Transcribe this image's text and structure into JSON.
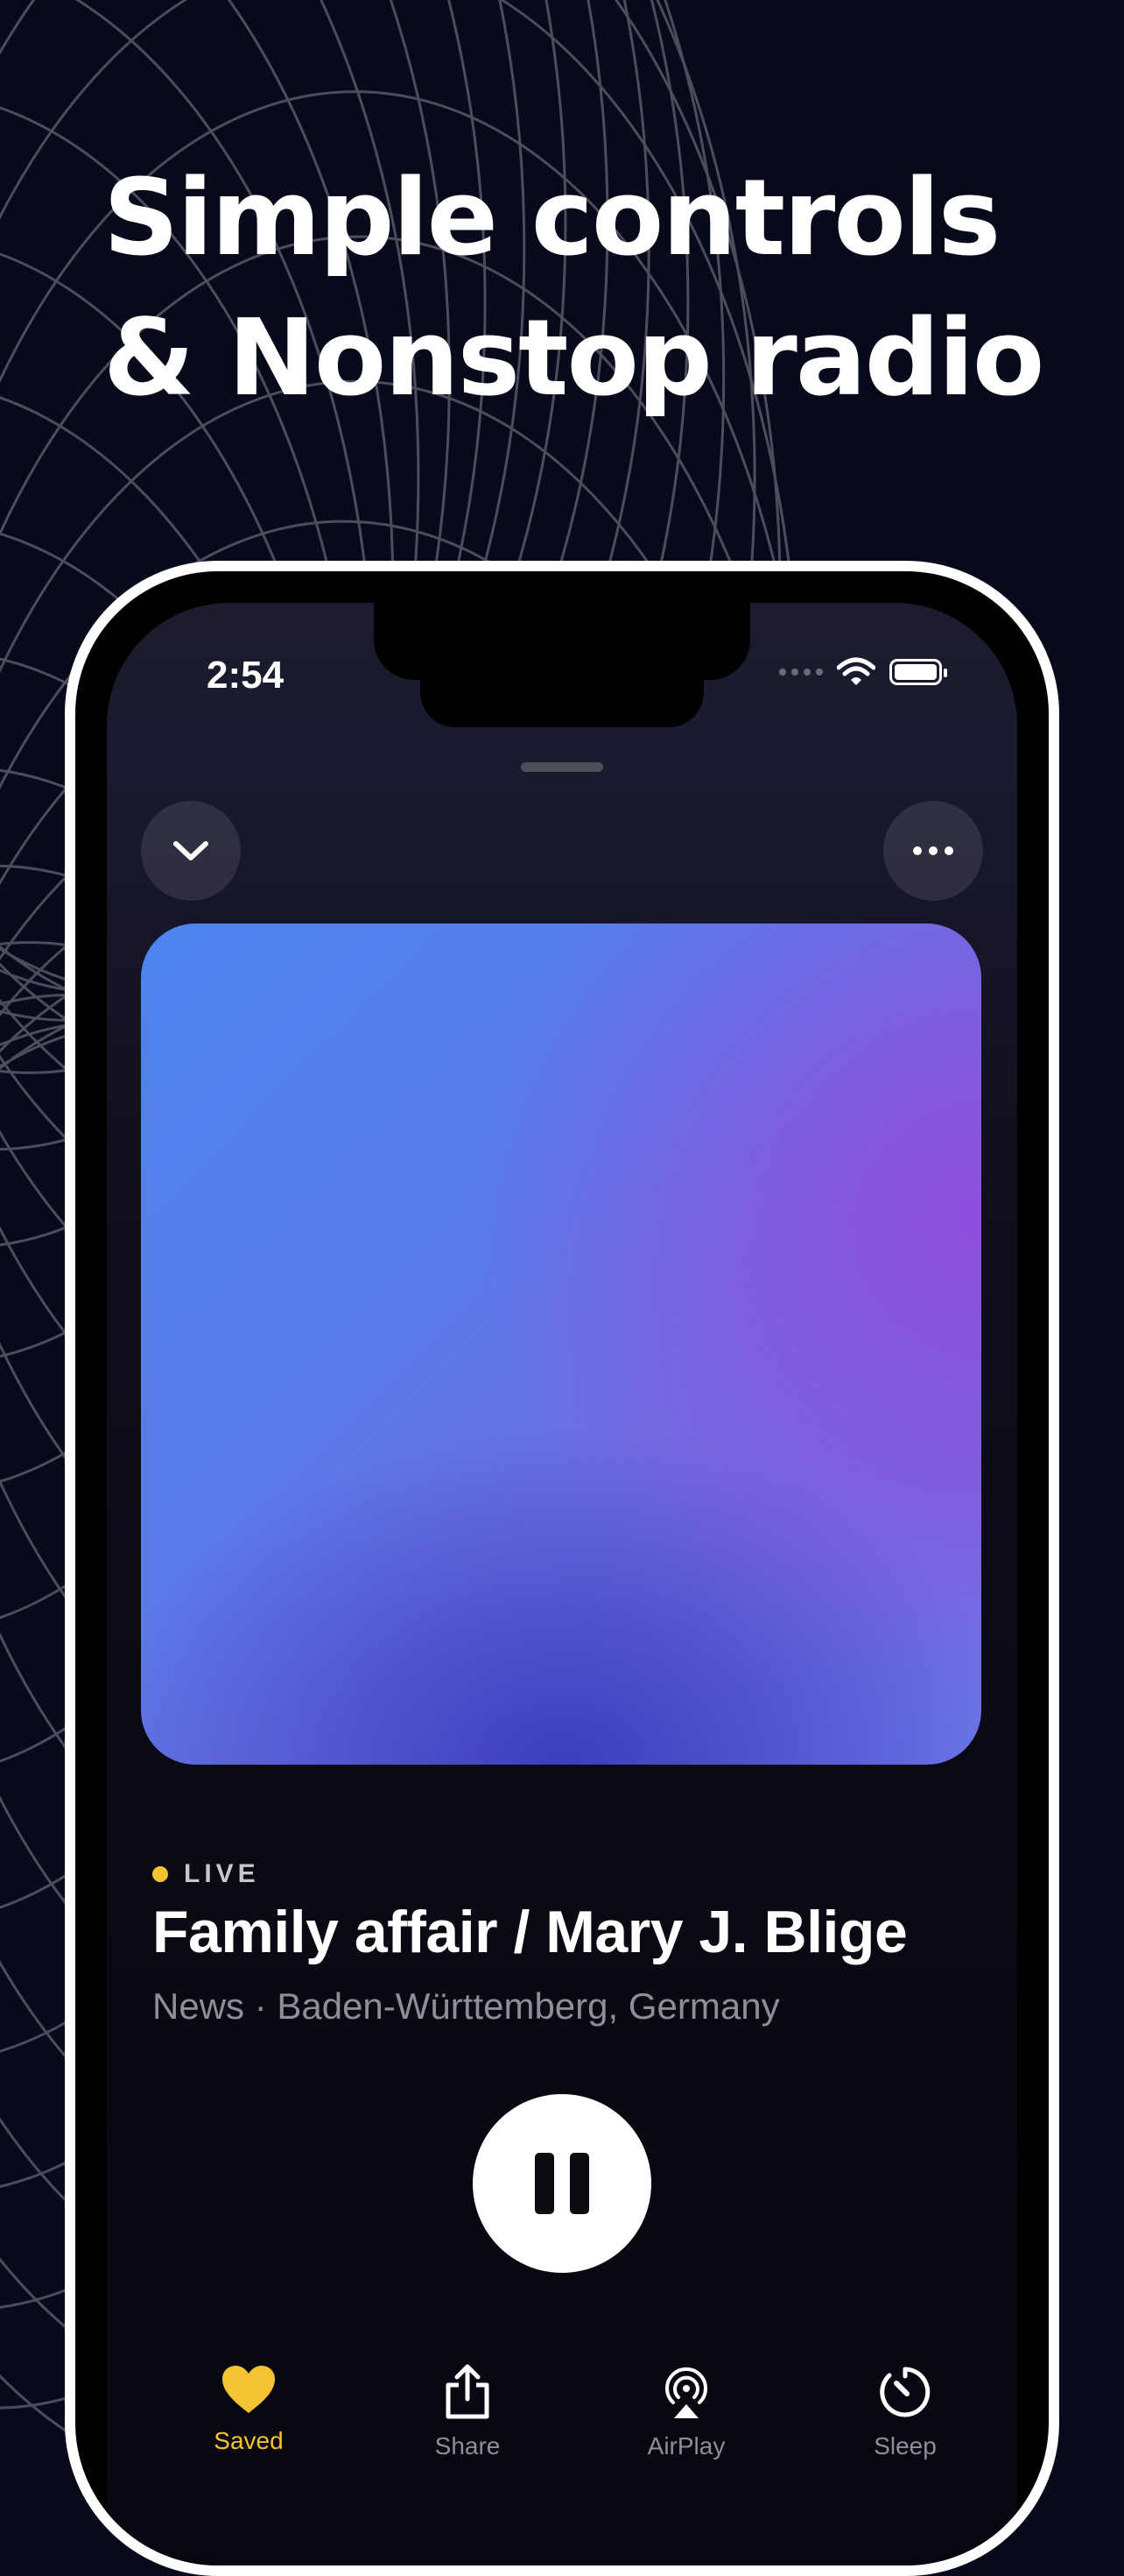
{
  "headline": {
    "line1": "Simple controls",
    "line2": "& Nonstop radio"
  },
  "status_bar": {
    "time": "2:54",
    "icons": [
      "signal-icon",
      "wifi-icon",
      "battery-icon"
    ]
  },
  "player": {
    "collapse_icon": "chevron-down-icon",
    "more_icon": "more-icon",
    "live_label": "LIVE",
    "track_title": "Family affair / Mary J. Blige",
    "subtitle": "News · Baden-Württemberg, Germany",
    "state": "playing",
    "artwork_colors": [
      "#4e84ee",
      "#8f4fdc",
      "#3a3fbc"
    ]
  },
  "tabs": [
    {
      "icon": "heart-icon",
      "label": "Saved",
      "active": true
    },
    {
      "icon": "share-icon",
      "label": "Share",
      "active": false
    },
    {
      "icon": "airplay-icon",
      "label": "AirPlay",
      "active": false
    },
    {
      "icon": "timer-icon",
      "label": "Sleep",
      "active": false
    }
  ],
  "colors": {
    "background": "#070a1a",
    "accent": "#f5c232",
    "text_secondary": "#8e8e98"
  }
}
